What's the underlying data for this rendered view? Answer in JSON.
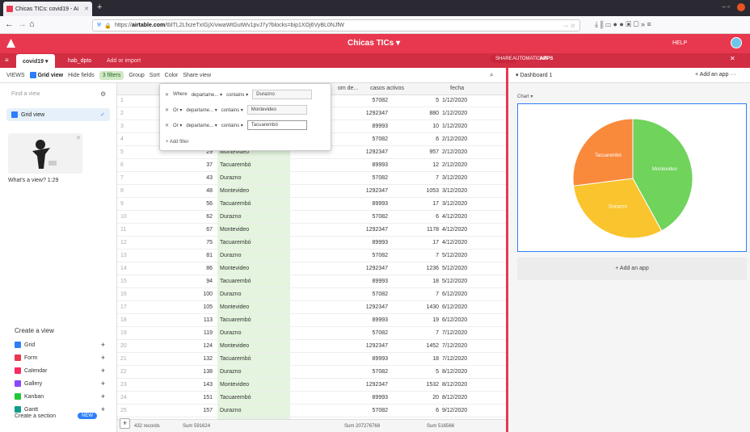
{
  "browser": {
    "tab_title": "Chicas TICs: covid19 - Ai",
    "url_domain": "airtable.com",
    "url_rest": "/tblTL2LfxzeTxIGjX/viwaWtGutWv1pvJ7y?blocks=bip1XOj6VyBL0NJfW",
    "back": "←",
    "forward": "→",
    "home": "⌂",
    "new_tab": "+",
    "url_icons": "··· ☆",
    "ext_icons": "⤓ ⫼ ▭ ● ● ▣ ▢ » ≡",
    "win_controls": "–  ▫"
  },
  "app": {
    "base_title": "Chicas TICs ▾",
    "help": "HELP",
    "share": "SHARE",
    "automations": "AUTOMATIONS",
    "apps": "APPS",
    "close": "✕"
  },
  "tables": {
    "t1": "covid19 ▾",
    "t2": "hab_dpto",
    "t3": "Add or import"
  },
  "viewbar": {
    "views": "VIEWS",
    "grid_view": "Grid view",
    "hide_fields": "Hide fields",
    "filters": "3 filters",
    "group": "Group",
    "sort": "Sort",
    "color": "Color",
    "share_view": "Share view"
  },
  "sidebar": {
    "find_placeholder": "Find a view",
    "grid_view_item": "Grid view",
    "whats_view": "What's a view? 1:29",
    "create_view": "Create a view",
    "create_section": "Create a section",
    "new_badge": "NEW",
    "view_types": [
      {
        "label": "Grid",
        "color": "#2d7ff9"
      },
      {
        "label": "Form",
        "color": "#e8384f"
      },
      {
        "label": "Calendar",
        "color": "#f82b60"
      },
      {
        "label": "Gallery",
        "color": "#8b46ff"
      },
      {
        "label": "Kanban",
        "color": "#20c933"
      },
      {
        "label": "Gantt",
        "color": "#0f9d8a"
      }
    ]
  },
  "grid": {
    "col_desde": "om de...",
    "col_casos": "casos activos",
    "col_fecha": "fecha",
    "rows": [
      {
        "n": "1",
        "dep": "",
        "pob": "57082",
        "casos": "5",
        "fecha": "1/12/2020"
      },
      {
        "n": "2",
        "dep": "",
        "pob": "1292347",
        "casos": "880",
        "fecha": "1/12/2020"
      },
      {
        "n": "3",
        "dep": "",
        "pob": "89993",
        "casos": "10",
        "fecha": "1/12/2020"
      },
      {
        "n": "4",
        "dep": "",
        "pob": "57082",
        "casos": "6",
        "fecha": "2/12/2020"
      },
      {
        "n": "5",
        "v": "29",
        "dep": "Montevideo",
        "pob": "1292347",
        "casos": "957",
        "fecha": "2/12/2020"
      },
      {
        "n": "6",
        "v": "37",
        "dep": "Tacuarembó",
        "pob": "89993",
        "casos": "12",
        "fecha": "2/12/2020"
      },
      {
        "n": "7",
        "v": "43",
        "dep": "Durazno",
        "pob": "57082",
        "casos": "7",
        "fecha": "3/12/2020"
      },
      {
        "n": "8",
        "v": "48",
        "dep": "Montevideo",
        "pob": "1292347",
        "casos": "1053",
        "fecha": "3/12/2020"
      },
      {
        "n": "9",
        "v": "56",
        "dep": "Tacuarembó",
        "pob": "89993",
        "casos": "17",
        "fecha": "3/12/2020"
      },
      {
        "n": "10",
        "v": "62",
        "dep": "Durazno",
        "pob": "57082",
        "casos": "6",
        "fecha": "4/12/2020"
      },
      {
        "n": "11",
        "v": "67",
        "dep": "Montevideo",
        "pob": "1292347",
        "casos": "1178",
        "fecha": "4/12/2020"
      },
      {
        "n": "12",
        "v": "75",
        "dep": "Tacuarembó",
        "pob": "89993",
        "casos": "17",
        "fecha": "4/12/2020"
      },
      {
        "n": "13",
        "v": "81",
        "dep": "Durazno",
        "pob": "57082",
        "casos": "7",
        "fecha": "5/12/2020"
      },
      {
        "n": "14",
        "v": "86",
        "dep": "Montevideo",
        "pob": "1292347",
        "casos": "1236",
        "fecha": "5/12/2020"
      },
      {
        "n": "15",
        "v": "94",
        "dep": "Tacuarembó",
        "pob": "89993",
        "casos": "18",
        "fecha": "5/12/2020"
      },
      {
        "n": "16",
        "v": "100",
        "dep": "Durazno",
        "pob": "57082",
        "casos": "7",
        "fecha": "6/12/2020"
      },
      {
        "n": "17",
        "v": "105",
        "dep": "Montevideo",
        "pob": "1292347",
        "casos": "1430",
        "fecha": "6/12/2020"
      },
      {
        "n": "18",
        "v": "113",
        "dep": "Tacuarembó",
        "pob": "89993",
        "casos": "19",
        "fecha": "6/12/2020"
      },
      {
        "n": "19",
        "v": "119",
        "dep": "Durazno",
        "pob": "57082",
        "casos": "7",
        "fecha": "7/12/2020"
      },
      {
        "n": "20",
        "v": "124",
        "dep": "Montevideo",
        "pob": "1292347",
        "casos": "1452",
        "fecha": "7/12/2020"
      },
      {
        "n": "21",
        "v": "132",
        "dep": "Tacuarembó",
        "pob": "89993",
        "casos": "18",
        "fecha": "7/12/2020"
      },
      {
        "n": "22",
        "v": "138",
        "dep": "Durazno",
        "pob": "57082",
        "casos": "5",
        "fecha": "8/12/2020"
      },
      {
        "n": "23",
        "v": "143",
        "dep": "Montevideo",
        "pob": "1292347",
        "casos": "1532",
        "fecha": "8/12/2020"
      },
      {
        "n": "24",
        "v": "151",
        "dep": "Tacuarembó",
        "pob": "89993",
        "casos": "20",
        "fecha": "8/12/2020"
      },
      {
        "n": "25",
        "v": "157",
        "dep": "Durazno",
        "pob": "57082",
        "casos": "6",
        "fecha": "9/12/2020"
      }
    ]
  },
  "footer": {
    "records": "432 records",
    "sum1": "Sum 591624",
    "sum2": "Sum 207276768",
    "sum3": "Sum 516566"
  },
  "filter": {
    "where": "Where",
    "or": "Or ▾",
    "field": "departame... ▾",
    "op": "contains ▾",
    "v1": "Durazno",
    "v2": "Montevideo",
    "v3": "Tacuarembó",
    "add": "+ Add filter"
  },
  "dashboard": {
    "name": "▾ Dashboard 1",
    "add_app": "+ Add an app ···",
    "chart_label": "Chart ▾",
    "add_app_button": "+ Add an app"
  },
  "chart_data": {
    "type": "pie",
    "labels": [
      "Montevideo",
      "Durazno",
      "Tacuarembó"
    ],
    "values": [
      0.42,
      0.31,
      0.27
    ],
    "colors": [
      "#6fd35c",
      "#f9c42d",
      "#f98a3c"
    ]
  }
}
